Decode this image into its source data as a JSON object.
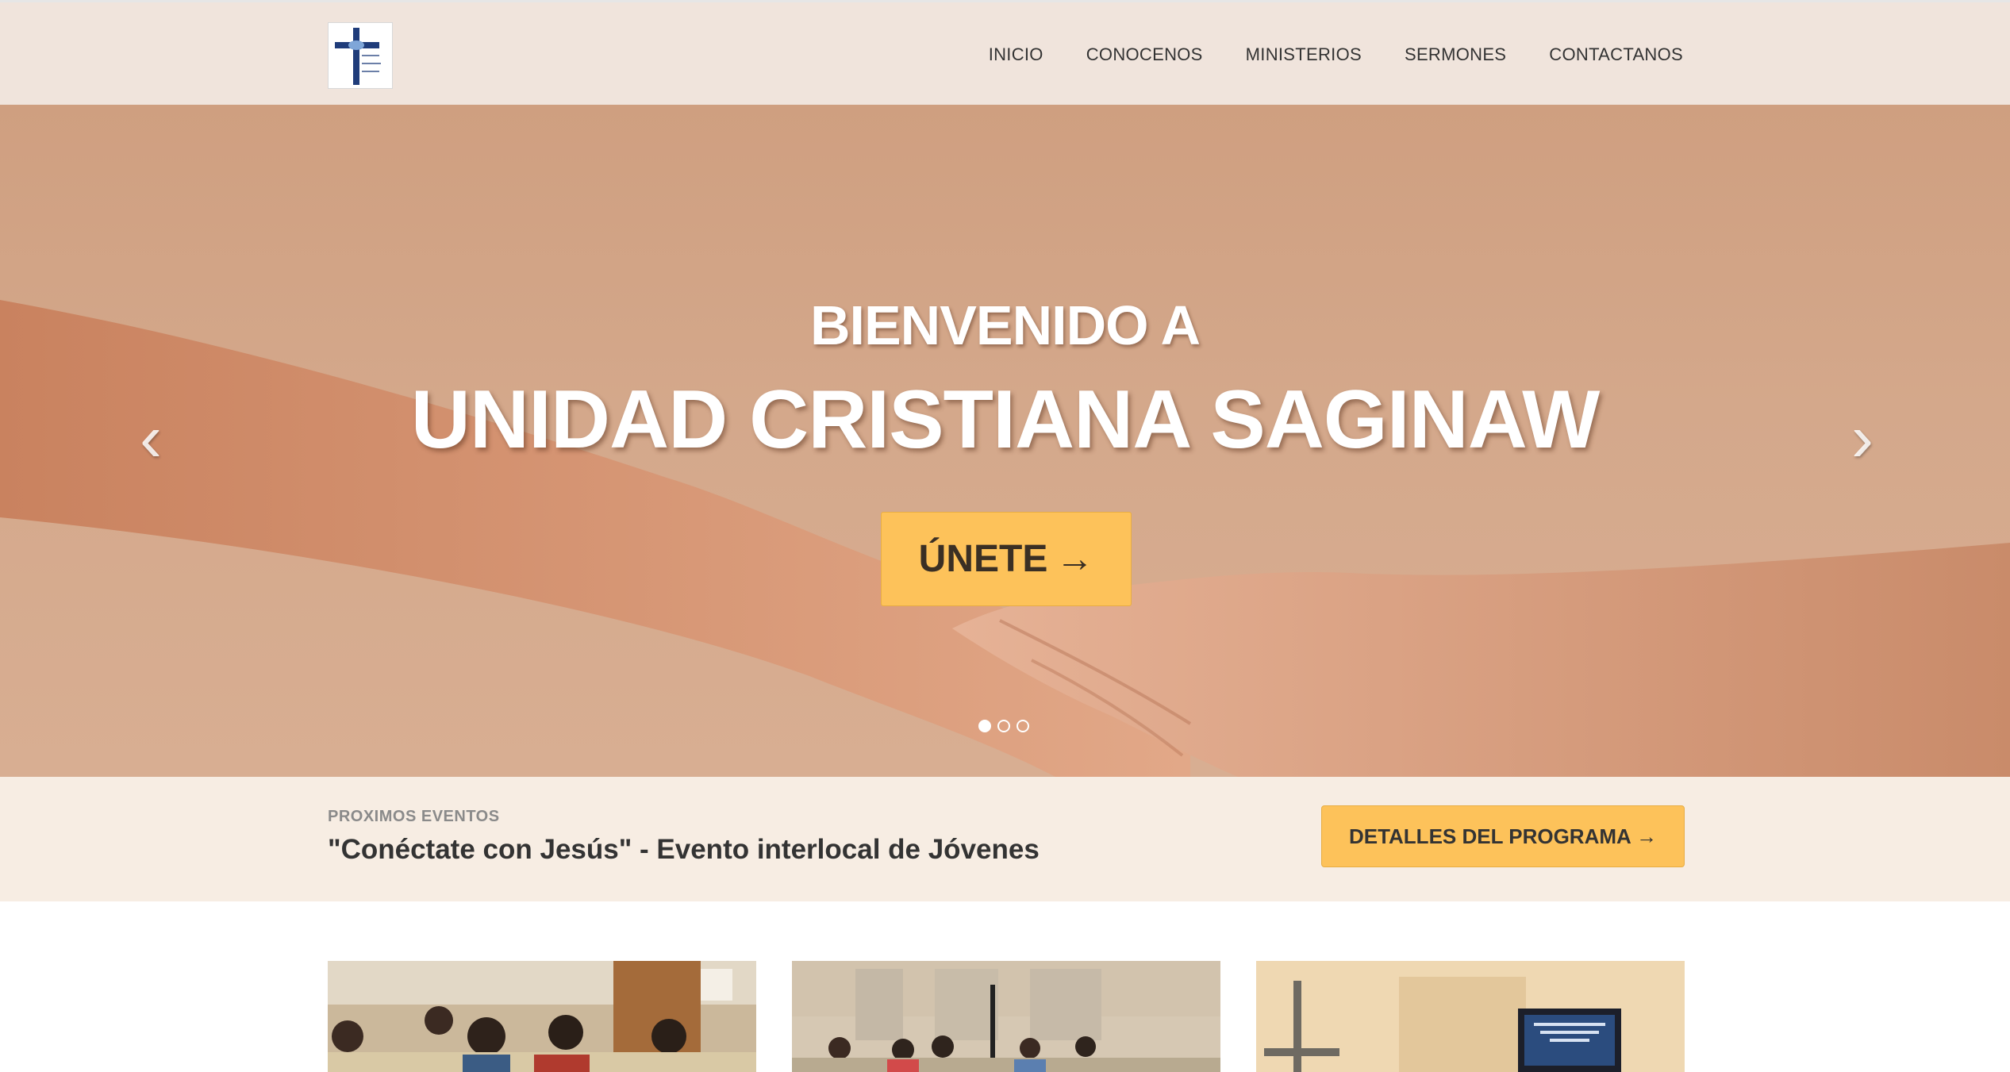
{
  "header": {
    "logo_alt_lines": [
      "Unidad",
      "Cristiana",
      "Saginaw"
    ],
    "nav": [
      {
        "label": "INICIO"
      },
      {
        "label": "CONOCENOS"
      },
      {
        "label": "MINISTERIOS"
      },
      {
        "label": "SERMONES"
      },
      {
        "label": "CONTACTANOS"
      }
    ]
  },
  "hero": {
    "kicker": "BIENVENIDO A",
    "title": "UNIDAD CRISTIANA SAGINAW",
    "cta_label": "ÚNETE",
    "cta_arrow": "→",
    "prev_icon": "chevron-left-icon",
    "next_icon": "chevron-right-icon",
    "slides_total": 3,
    "slide_active": 1
  },
  "events": {
    "kicker": "PROXIMOS EVENTOS",
    "title": "\"Conéctate con Jesús\" - Evento interlocal de Jóvenes",
    "button_label": "DETALLES DEL PROGRAMA →"
  },
  "colors": {
    "nav_bg": "#f0e4dc",
    "accent": "#fdc25a",
    "events_bg": "#f7ede3",
    "logo_blue": "#1f3c7a"
  }
}
